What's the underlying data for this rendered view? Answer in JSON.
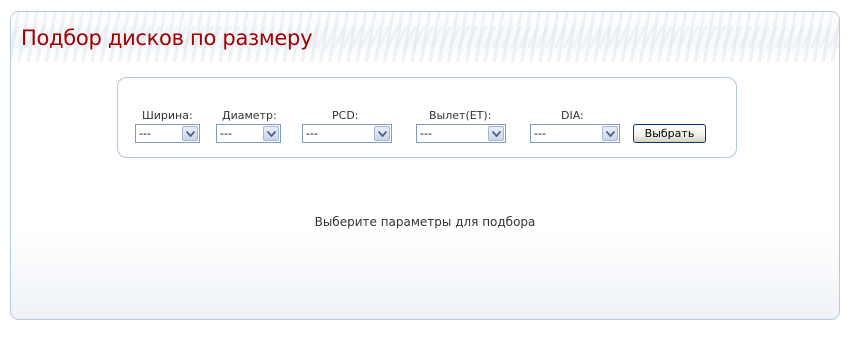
{
  "header": {
    "title": "Подбор дисков по размеру"
  },
  "filters": {
    "width": {
      "label": "Ширина:",
      "value": "---"
    },
    "diameter": {
      "label": "Диаметр:",
      "value": "---"
    },
    "pcd": {
      "label": "PCD:",
      "value": "---"
    },
    "offset": {
      "label": "Вылет(ET):",
      "value": "---"
    },
    "dia": {
      "label": "DIA:",
      "value": "---"
    },
    "submit_label": "Выбрать"
  },
  "results": {
    "message": "Выберите параметры для подбора"
  },
  "colors": {
    "title": "#a30000",
    "border": "#b8c9da",
    "select_border": "#7f9db9"
  },
  "icons": {
    "dropdown": "chevron-down-icon"
  }
}
